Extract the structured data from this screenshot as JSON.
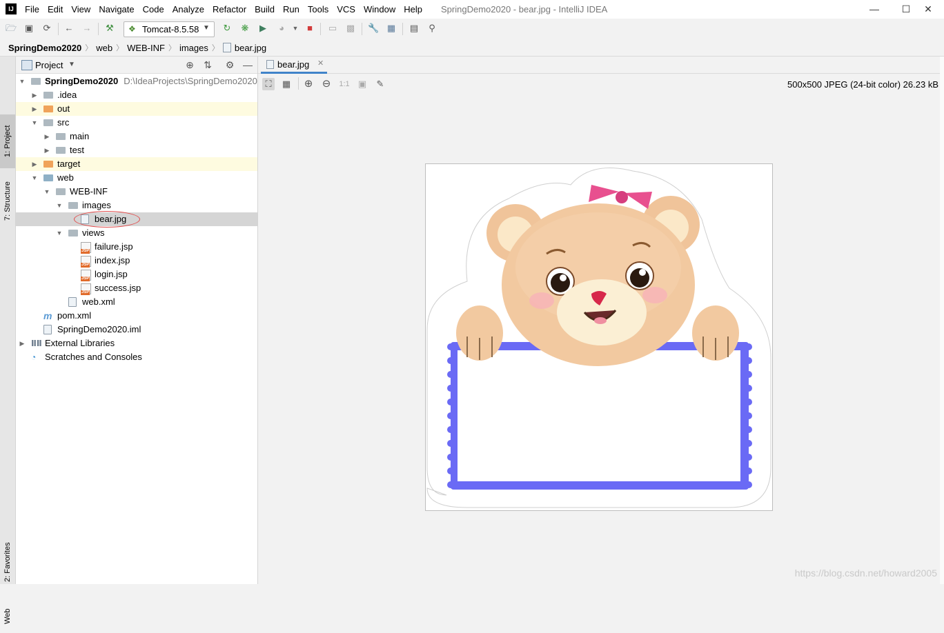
{
  "window": {
    "title": "SpringDemo2020 - bear.jpg - IntelliJ IDEA",
    "menu": [
      "File",
      "Edit",
      "View",
      "Navigate",
      "Code",
      "Analyze",
      "Refactor",
      "Build",
      "Run",
      "Tools",
      "VCS",
      "Window",
      "Help"
    ],
    "controls": [
      "minimize-icon",
      "maximize-icon",
      "close-icon"
    ]
  },
  "toolbar": {
    "run_config": "Tomcat-8.5.58",
    "icons": [
      "open-folder-icon",
      "save-icon",
      "sync-icon",
      "back-icon",
      "forward-icon",
      "build-hammer-icon",
      "rerun-icon",
      "debug-icon",
      "run-coverage-icon",
      "profile-icon",
      "stop-icon",
      "attach-icon",
      "device-icon",
      "wrench-icon",
      "project-structure-icon",
      "terminal-icon",
      "search-icon"
    ]
  },
  "breadcrumb": [
    "SpringDemo2020",
    "web",
    "WEB-INF",
    "images",
    "bear.jpg"
  ],
  "side_tabs": {
    "project": "1: Project",
    "structure": "7: Structure",
    "favorites": "2: Favorites",
    "web": "Web"
  },
  "project_panel": {
    "title": "Project",
    "tree": [
      {
        "label": "SpringDemo2020",
        "path": "D:\\IdeaProjects\\SpringDemo2020",
        "depth": 0,
        "kind": "module",
        "expanded": true
      },
      {
        "label": ".idea",
        "depth": 1,
        "kind": "folder-grey",
        "expanded": false
      },
      {
        "label": "out",
        "depth": 1,
        "kind": "folder-orange",
        "expanded": false,
        "highlight": true
      },
      {
        "label": "src",
        "depth": 1,
        "kind": "folder-grey",
        "expanded": true
      },
      {
        "label": "main",
        "depth": 2,
        "kind": "folder-grey",
        "expanded": false
      },
      {
        "label": "test",
        "depth": 2,
        "kind": "folder-grey",
        "expanded": false
      },
      {
        "label": "target",
        "depth": 1,
        "kind": "folder-orange",
        "expanded": false,
        "highlight": true
      },
      {
        "label": "web",
        "depth": 1,
        "kind": "folder-blue",
        "expanded": true
      },
      {
        "label": "WEB-INF",
        "depth": 2,
        "kind": "folder-grey",
        "expanded": true
      },
      {
        "label": "images",
        "depth": 3,
        "kind": "folder-grey",
        "expanded": true
      },
      {
        "label": "bear.jpg",
        "depth": 4,
        "kind": "image",
        "selected": true
      },
      {
        "label": "views",
        "depth": 3,
        "kind": "folder-grey",
        "expanded": true
      },
      {
        "label": "failure.jsp",
        "depth": 4,
        "kind": "jsp"
      },
      {
        "label": "index.jsp",
        "depth": 4,
        "kind": "jsp"
      },
      {
        "label": "login.jsp",
        "depth": 4,
        "kind": "jsp"
      },
      {
        "label": "success.jsp",
        "depth": 4,
        "kind": "jsp"
      },
      {
        "label": "web.xml",
        "depth": 3,
        "kind": "xml"
      },
      {
        "label": "pom.xml",
        "depth": 1,
        "kind": "maven"
      },
      {
        "label": "SpringDemo2020.iml",
        "depth": 1,
        "kind": "iml"
      },
      {
        "label": "External Libraries",
        "depth": 0,
        "kind": "libraries",
        "expanded": false
      },
      {
        "label": "Scratches and Consoles",
        "depth": 0,
        "kind": "scratches"
      }
    ]
  },
  "editor": {
    "tab_label": "bear.jpg",
    "image_info": "500x500 JPEG (24-bit color) 26.23 kB",
    "image_toolbar_icons": [
      "fit-icon",
      "grid-icon",
      "zoom-in-icon",
      "zoom-out-icon",
      "actual-size-label",
      "background-icon",
      "color-picker-icon"
    ],
    "actual_size_label": "1:1"
  },
  "watermark": "https://blog.csdn.net/howard2005",
  "colors": {
    "accent": "#4083c9",
    "selection": "#d5d5d5",
    "highlight": "#fefbe0",
    "frame_blue": "#6a6af5",
    "bear": "#f2c9a0"
  }
}
